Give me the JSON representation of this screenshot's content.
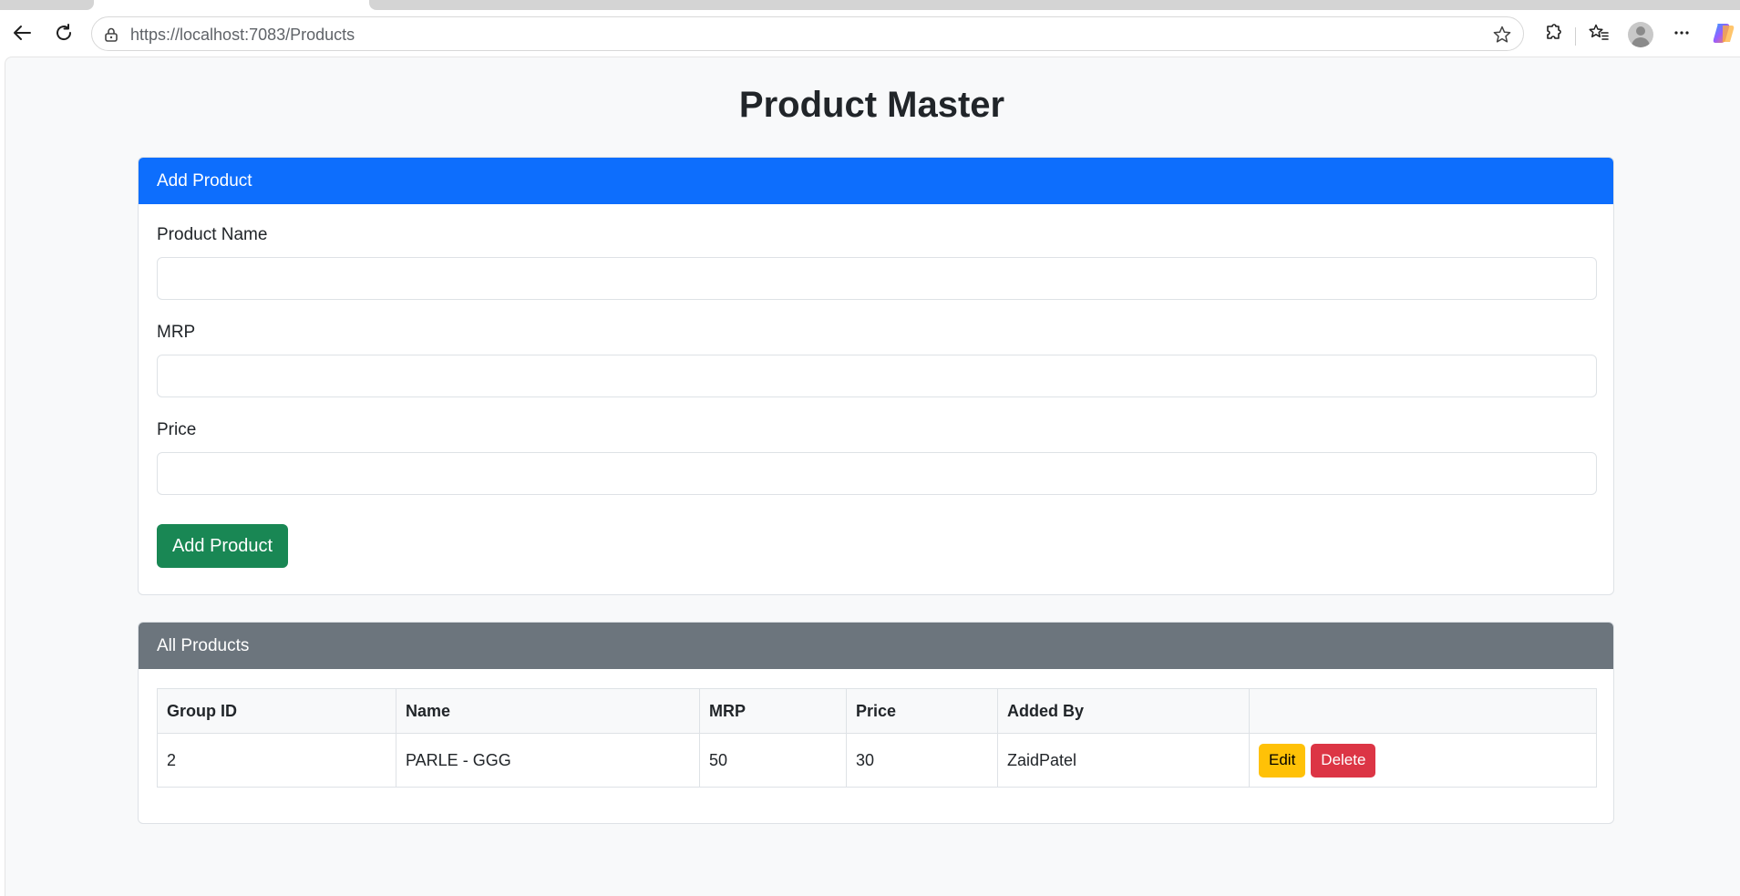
{
  "browser": {
    "url_host": "https://localhost",
    "url_rest": ":7083/Products",
    "icons": [
      "back-icon",
      "refresh-icon",
      "lock-icon",
      "star-icon",
      "extensions-icon",
      "favorites-icon",
      "profile-avatar",
      "more-icon",
      "copilot-icon"
    ]
  },
  "page": {
    "title": "Product Master"
  },
  "add_card": {
    "header": "Add Product",
    "fields": [
      {
        "label": "Product Name",
        "value": ""
      },
      {
        "label": "MRP",
        "value": ""
      },
      {
        "label": "Price",
        "value": ""
      }
    ],
    "submit_label": "Add Product"
  },
  "list_card": {
    "header": "All Products",
    "columns": [
      "Group ID",
      "Name",
      "MRP",
      "Price",
      "Added By",
      ""
    ],
    "rows": [
      {
        "group_id": "2",
        "name": "PARLE - GGG",
        "mrp": "50",
        "price": "30",
        "added_by": "ZaidPatel",
        "edit_label": "Edit",
        "delete_label": "Delete"
      }
    ]
  },
  "colors": {
    "primary": "#0d6efd",
    "secondary": "#6c757d",
    "success": "#198754",
    "warning": "#ffc107",
    "danger": "#dc3545"
  }
}
